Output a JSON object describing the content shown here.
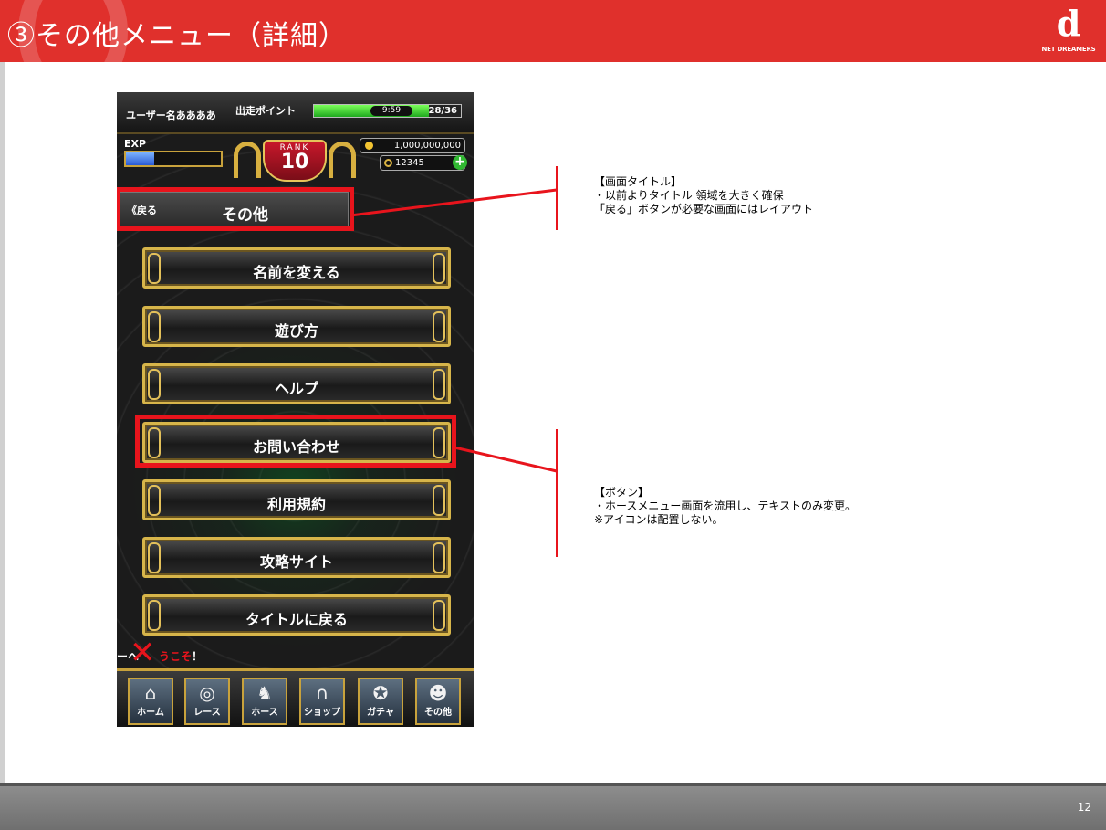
{
  "slide": {
    "title": "③その他メニュー（詳細）",
    "logo_mark": "d",
    "logo_text": "NET DREAMERS",
    "page_number": "12"
  },
  "phone": {
    "username": "ユーザー名ああああ",
    "points_label": "出走ポイント",
    "points_timer": "9:59",
    "points_count": "28/36",
    "points_fraction": 0.78,
    "exp_label": "EXP",
    "exp_fraction": 0.3,
    "rank_label": "RANK",
    "rank_value": "10",
    "coins": "1,000,000,000",
    "rings": "12345",
    "plus_symbol": "+",
    "back_button": "《戻る",
    "page_title": "その他",
    "menu": [
      {
        "label": "名前を変える"
      },
      {
        "label": "遊び方"
      },
      {
        "label": "ヘルプ"
      },
      {
        "label": "お問い合わせ"
      },
      {
        "label": "利用規約"
      },
      {
        "label": "攻略サイト"
      },
      {
        "label": "タイトルに戻る"
      }
    ],
    "ticker_prefix": "ーへ",
    "ticker_red": "うこそ",
    "ticker_suffix": "！",
    "ticker_mark": "✕",
    "nav": [
      {
        "label": "ホーム",
        "icon": "home-icon",
        "glyph": "⌂"
      },
      {
        "label": "レース",
        "icon": "race-icon",
        "glyph": "◎"
      },
      {
        "label": "ホース",
        "icon": "horse-icon",
        "glyph": "♞"
      },
      {
        "label": "ショップ",
        "icon": "horseshoe-icon",
        "glyph": "∩"
      },
      {
        "label": "ガチャ",
        "icon": "gacha-icon",
        "glyph": "✪"
      },
      {
        "label": "その他",
        "icon": "other-icon",
        "glyph": "☻"
      }
    ]
  },
  "annotations": {
    "title_note": {
      "heading": "【画面タイトル】",
      "line1": "・以前よりタイトル 領域を大きく確保",
      "line2": "「戻る」ボタンが必要な画面にはレイアウト"
    },
    "button_note": {
      "heading": "【ボタン】",
      "line1": "・ホースメニュー画面を流用し、テキストのみ変更。",
      "line2": "※アイコンは配置しない。"
    }
  },
  "colors": {
    "header_red": "#e0302c",
    "highlight_red": "#e8141c",
    "gold": "#d7b54a"
  }
}
